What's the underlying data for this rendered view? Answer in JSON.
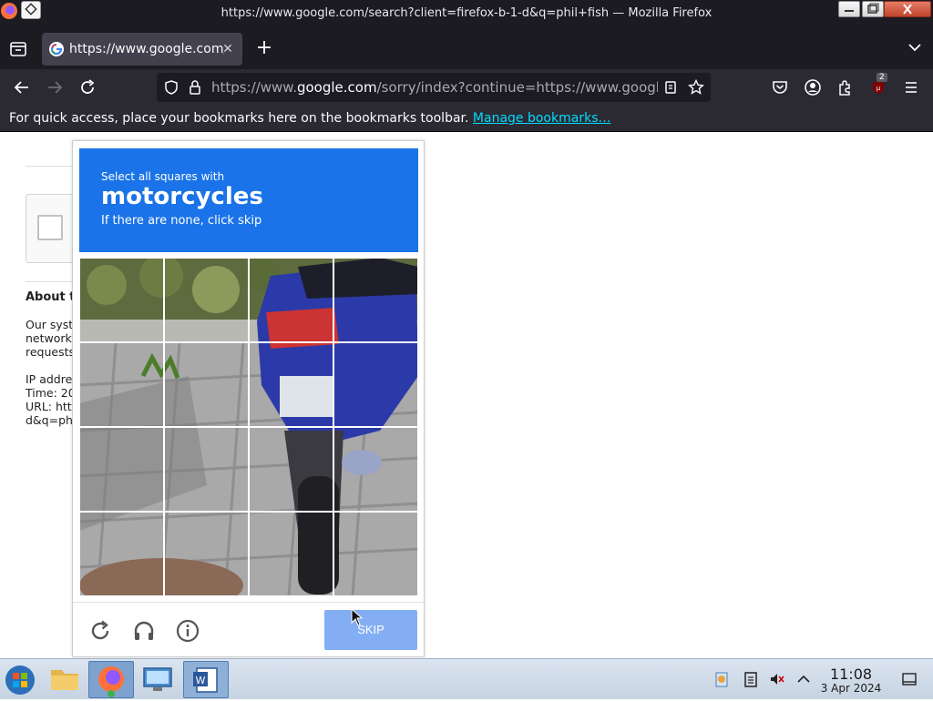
{
  "window": {
    "title": "https://www.google.com/search?client=firefox-b-1-d&q=phil+fish — Mozilla Firefox"
  },
  "tabs": [
    {
      "label": "https://www.google.com/",
      "active": true
    }
  ],
  "navbar": {
    "url_prefix": "https://www.",
    "url_domain": "google.com",
    "url_rest": "/sorry/index?continue=https://www.google.co",
    "extension_badge_count": "2"
  },
  "bookmarks_bar": {
    "message": "For quick access, place your bookmarks here on the bookmarks toolbar.",
    "link": "Manage bookmarks…"
  },
  "page": {
    "about_heading": "About th",
    "about_lines": [
      "Our syste",
      "network.",
      "requests",
      "",
      "IP addres",
      "Time: 20",
      "URL: http",
      "d&q=phil"
    ]
  },
  "captcha": {
    "instruction_small": "Select all squares with",
    "target": "motorcycles",
    "hint": "If there are none, click skip",
    "grid_size": 4,
    "skip_label": "SKIP",
    "header_color": "#1a73e8",
    "skip_color": "#83aef3"
  },
  "taskbar": {
    "time": "11:08",
    "date": "3 Apr 2024"
  }
}
